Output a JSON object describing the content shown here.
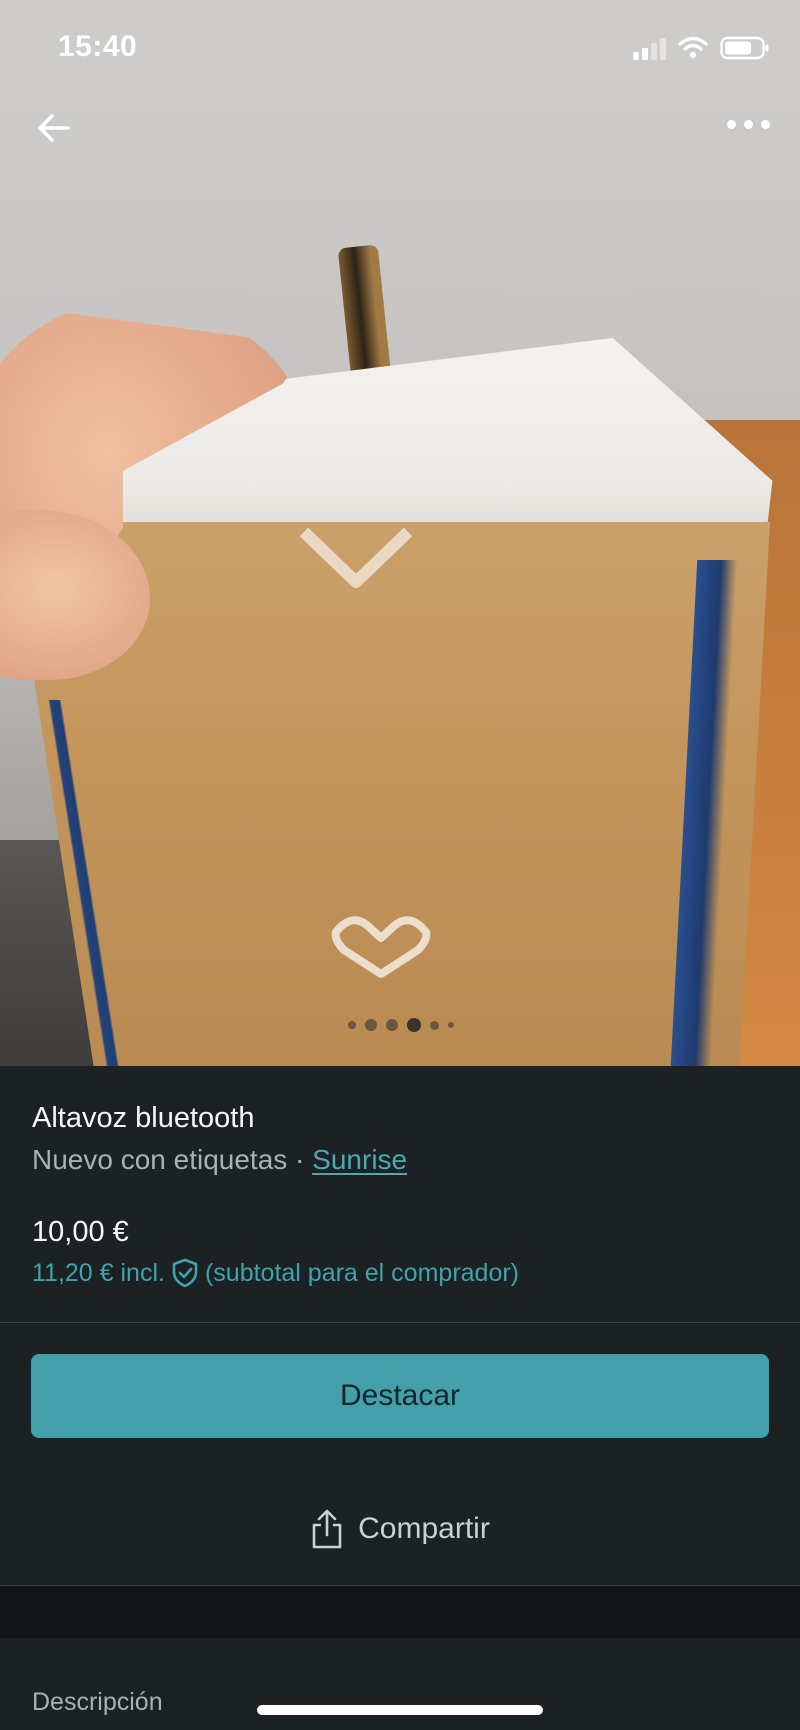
{
  "status_bar": {
    "time": "15:40"
  },
  "navigation": {
    "back_icon": "arrow-left-icon",
    "more_icon": "more-horizontal-icon"
  },
  "gallery": {
    "total_photos": 6,
    "active_index": 3
  },
  "item": {
    "title": "Altavoz bluetooth",
    "condition": "Nuevo con etiquetas",
    "separator": "·",
    "brand": "Sunrise",
    "price": "10,00 €",
    "price_incl": "11,20 € incl.",
    "buyer_note": "(subtotal para el comprador)"
  },
  "actions": {
    "promote_label": "Destacar",
    "share_label": "Compartir"
  },
  "description": {
    "label": "Descripción"
  },
  "colors": {
    "accent": "#43a0ab",
    "link": "#4aa9b4",
    "background": "#1c2124"
  }
}
